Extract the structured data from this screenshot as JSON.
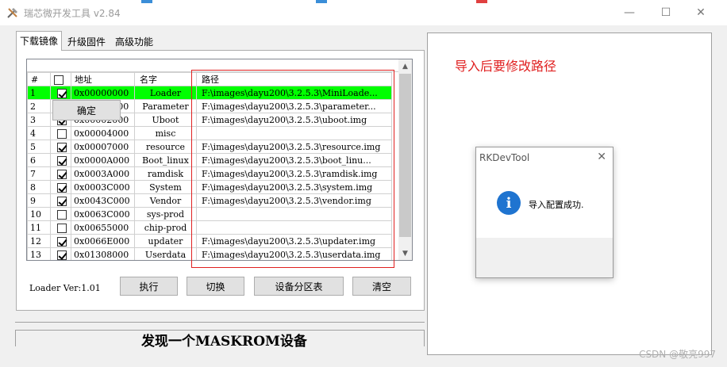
{
  "window": {
    "title": "瑞芯微开发工具 v2.84",
    "minimize": "—",
    "maximize": "☐",
    "close": "✕"
  },
  "tabs": [
    "下载镜像",
    "升级固件",
    "高级功能"
  ],
  "table": {
    "headers": [
      "#",
      "",
      "地址",
      "名字",
      "路径"
    ],
    "rows": [
      {
        "num": "1",
        "checked": true,
        "addr": "0x00000000",
        "name": "Loader",
        "path": "F:\\images\\dayu200\\3.2.5.3\\MiniLoade..."
      },
      {
        "num": "2",
        "checked": true,
        "addr": "0x00000000",
        "name": "Parameter",
        "path": "F:\\images\\dayu200\\3.2.5.3\\parameter..."
      },
      {
        "num": "3",
        "checked": true,
        "addr": "0x00002000",
        "name": "Uboot",
        "path": "F:\\images\\dayu200\\3.2.5.3\\uboot.img"
      },
      {
        "num": "4",
        "checked": false,
        "addr": "0x00004000",
        "name": "misc",
        "path": ""
      },
      {
        "num": "5",
        "checked": true,
        "addr": "0x00007000",
        "name": "resource",
        "path": "F:\\images\\dayu200\\3.2.5.3\\resource.img"
      },
      {
        "num": "6",
        "checked": true,
        "addr": "0x0000A000",
        "name": "Boot_linux",
        "path": "F:\\images\\dayu200\\3.2.5.3\\boot_linu..."
      },
      {
        "num": "7",
        "checked": true,
        "addr": "0x0003A000",
        "name": "ramdisk",
        "path": "F:\\images\\dayu200\\3.2.5.3\\ramdisk.img"
      },
      {
        "num": "8",
        "checked": true,
        "addr": "0x0003C000",
        "name": "System",
        "path": "F:\\images\\dayu200\\3.2.5.3\\system.img"
      },
      {
        "num": "9",
        "checked": true,
        "addr": "0x0043C000",
        "name": "Vendor",
        "path": "F:\\images\\dayu200\\3.2.5.3\\vendor.img"
      },
      {
        "num": "10",
        "checked": false,
        "addr": "0x0063C000",
        "name": "sys-prod",
        "path": ""
      },
      {
        "num": "11",
        "checked": false,
        "addr": "0x00655000",
        "name": "chip-prod",
        "path": ""
      },
      {
        "num": "12",
        "checked": true,
        "addr": "0x0066E000",
        "name": "updater",
        "path": "F:\\images\\dayu200\\3.2.5.3\\updater.img"
      },
      {
        "num": "13",
        "checked": true,
        "addr": "0x01308000",
        "name": "Userdata",
        "path": "F:\\images\\dayu200\\3.2.5.3\\userdata.img"
      }
    ]
  },
  "loader_ver": "Loader Ver:1.01",
  "buttons": {
    "execute": "执行",
    "switch": "切换",
    "partition": "设备分区表",
    "clear": "清空"
  },
  "status": "发现一个MASKROM设备",
  "note": "导入后要修改路径",
  "dialog": {
    "title": "RKDevTool",
    "close": "✕",
    "icon": "i",
    "message": "导入配置成功.",
    "ok": "确定"
  },
  "watermark": "CSDN @敬亮997",
  "colors": {
    "selected_row": "#00ff00",
    "annotation": "#e02020",
    "info_icon": "#1f74d0"
  }
}
